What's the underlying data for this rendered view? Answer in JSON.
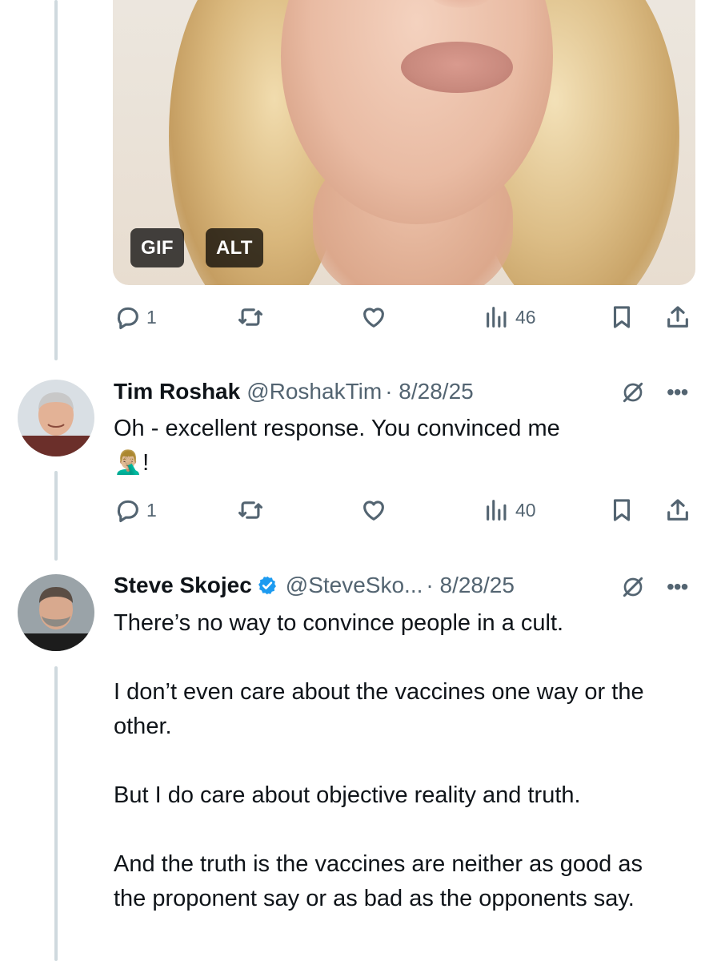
{
  "media": {
    "gif_badge": "GIF",
    "alt_badge": "ALT"
  },
  "first_tweet_actions": {
    "replies": "1",
    "retweets": "",
    "likes": "",
    "views": "46"
  },
  "tweets": [
    {
      "name": "Tim Roshak",
      "handle": "@RoshakTim",
      "date": "· 8/28/25",
      "verified": false,
      "text_lines": [
        "Oh - excellent response. You convinced me"
      ],
      "emoji": "🤦🏼‍♂️",
      "emoji_suffix": "!",
      "actions": {
        "replies": "1",
        "views": "40"
      }
    },
    {
      "name": "Steve Skojec",
      "handle": "@SteveSko...",
      "date": "· 8/28/25",
      "verified": true,
      "paragraphs": [
        "There’s no way to convince people in a cult.",
        "I don’t even care about the vaccines one way or the other.",
        "But I do care about objective reality and truth.",
        "And the truth is the vaccines are neither as good as the proponent say or as bad as the opponents say."
      ]
    }
  ],
  "icons": {
    "reply": "reply-icon",
    "retweet": "retweet-icon",
    "like": "heart-icon",
    "views": "views-icon",
    "bookmark": "bookmark-icon",
    "share": "share-icon",
    "grok": "grok-icon",
    "more": "more-icon",
    "verified": "verified-badge-icon"
  },
  "colors": {
    "text": "#0f1419",
    "secondary": "#536471",
    "thread_line": "#cfd9de",
    "verified": "#1d9bf0"
  }
}
